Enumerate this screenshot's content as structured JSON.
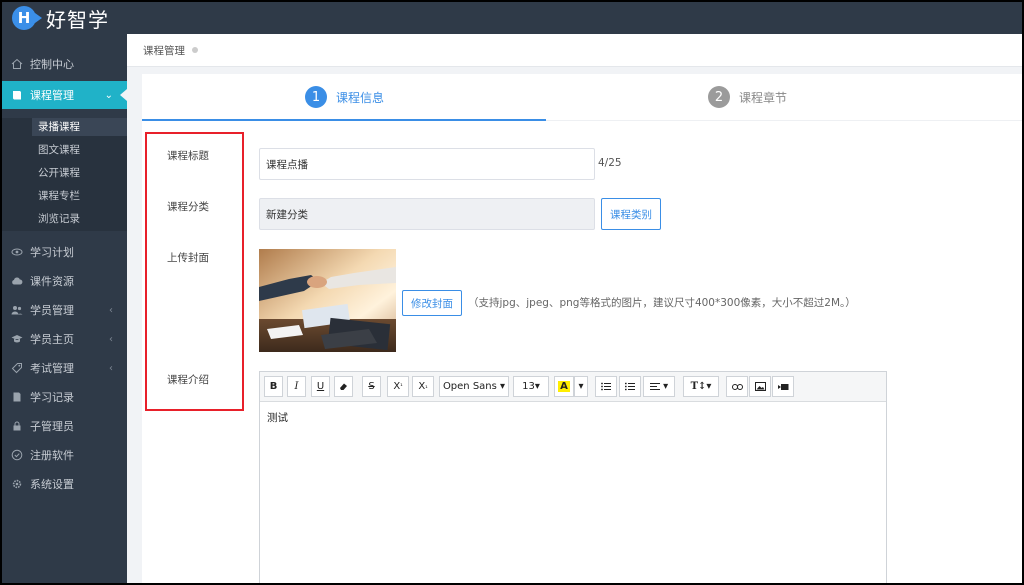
{
  "app": {
    "logo_letter": "H",
    "name": "好智学"
  },
  "sidebar": {
    "items": [
      {
        "label": "控制中心",
        "icon": "home-icon"
      },
      {
        "label": "课程管理",
        "icon": "book-icon",
        "active": true
      },
      {
        "label": "学习计划",
        "icon": "eye-icon"
      },
      {
        "label": "课件资源",
        "icon": "cloud-icon"
      },
      {
        "label": "学员管理",
        "icon": "users-icon"
      },
      {
        "label": "学员主页",
        "icon": "graduation-cap-icon"
      },
      {
        "label": "考试管理",
        "icon": "tag-icon"
      },
      {
        "label": "学习记录",
        "icon": "document-icon"
      },
      {
        "label": "子管理员",
        "icon": "lock-icon"
      },
      {
        "label": "注册软件",
        "icon": "check-circle-icon"
      },
      {
        "label": "系统设置",
        "icon": "gear-icon"
      }
    ],
    "sub_items": [
      "录播课程",
      "图文课程",
      "公开课程",
      "课程专栏",
      "浏览记录"
    ]
  },
  "breadcrumb": {
    "label": "课程管理"
  },
  "steps": [
    {
      "num": "1",
      "label": "课程信息",
      "active": true
    },
    {
      "num": "2",
      "label": "课程章节",
      "active": false
    }
  ],
  "form": {
    "title_label": "课程标题",
    "title_value": "课程点播",
    "title_counter": "4/25",
    "category_label": "课程分类",
    "category_value": "新建分类",
    "category_button": "课程类别",
    "cover_label": "上传封面",
    "cover_button": "修改封面",
    "cover_hint": "（支持jpg、jpeg、png等格式的图片，建议尺寸400*300像素，大小不超过2M。）",
    "intro_label": "课程介绍"
  },
  "editor": {
    "font_family": "Open Sans",
    "font_size": "13",
    "content": "测试"
  },
  "colors": {
    "accent": "#3a8ee6",
    "sidebar_active": "#20b2c8",
    "sidebar_bg": "#2f3a48",
    "highlight_box": "#e8202a"
  }
}
